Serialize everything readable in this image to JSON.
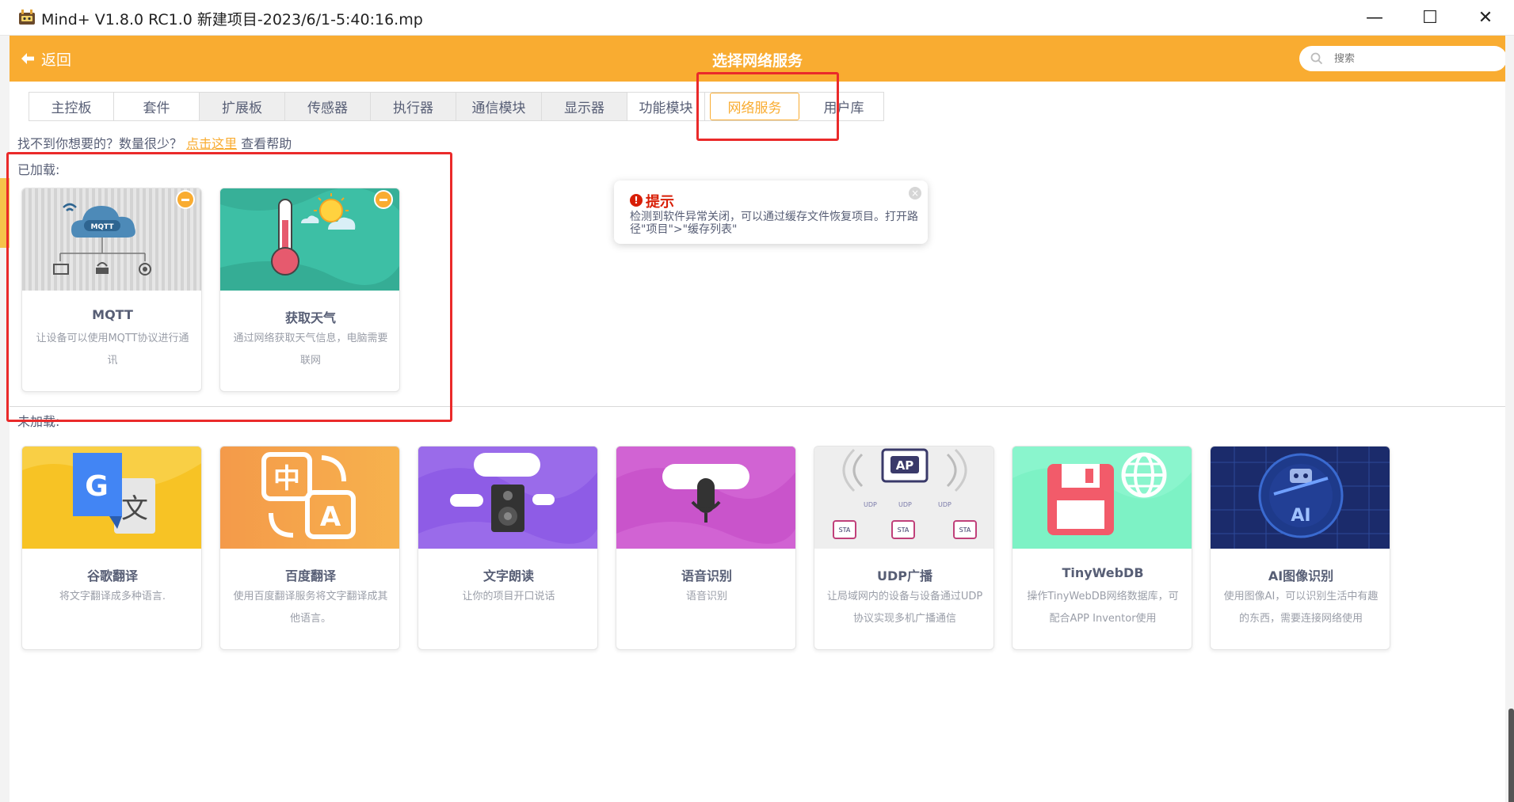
{
  "window": {
    "title": "Mind+ V1.8.0 RC1.0   新建项目-2023/6/1-5:40:16.mp",
    "min_glyph": "—",
    "max_glyph": "☐",
    "close_glyph": "✕"
  },
  "header": {
    "back_label": "返回",
    "title": "选择网络服务",
    "search_placeholder": "搜索"
  },
  "tabs": [
    {
      "label": "主控板"
    },
    {
      "label": "套件"
    },
    {
      "label": "扩展板"
    },
    {
      "label": "传感器"
    },
    {
      "label": "执行器"
    },
    {
      "label": "通信模块"
    },
    {
      "label": "显示器"
    },
    {
      "label": "功能模块"
    },
    {
      "label": "网络服务",
      "active": true
    },
    {
      "label": "用户库"
    }
  ],
  "help": {
    "prefix": "找不到你想要的？数量很少？",
    "link": "点击这里",
    "suffix": "查看帮助"
  },
  "sections": {
    "loaded": "已加载:",
    "unloaded": "未加载:"
  },
  "loaded_cards": [
    {
      "name": "MQTT",
      "desc": "让设备可以使用MQTT协议进行通讯",
      "icon": "mqtt-cloud-icon"
    },
    {
      "name": "获取天气",
      "desc": "通过网络获取天气信息，电脑需要联网",
      "icon": "thermometer-sun-icon"
    }
  ],
  "unloaded_cards": [
    {
      "name": "谷歌翻译",
      "desc": "将文字翻译成多种语言.",
      "icon": "google-translate-icon"
    },
    {
      "name": "百度翻译",
      "desc": "使用百度翻译服务将文字翻译成其他语言。",
      "icon": "translate-zh-a-icon"
    },
    {
      "name": "文字朗读",
      "desc": "让你的项目开口说话",
      "icon": "speaker-icon"
    },
    {
      "name": "语音识别",
      "desc": "语音识别",
      "icon": "microphone-icon"
    },
    {
      "name": "UDP广播",
      "desc": "让局域网内的设备与设备通过UDP协议实现多机广播通信",
      "icon": "udp-ap-icon"
    },
    {
      "name": "TinyWebDB",
      "desc": "操作TinyWebDB网络数据库，可配合APP Inventor使用",
      "icon": "save-globe-icon"
    },
    {
      "name": "AI图像识别",
      "desc": "使用图像AI，可以识别生活中有趣的东西，需要连接网络使用",
      "icon": "ai-robot-icon"
    }
  ],
  "tooltip": {
    "title": "提示",
    "text": "检测到软件异常关闭，可以通过缓存文件恢复项目。打开路径\"项目\">\"缓存列表\""
  },
  "colors": {
    "accent": "#f9ac31",
    "highlight": "#ea2a2a",
    "warning": "#d81e06"
  }
}
